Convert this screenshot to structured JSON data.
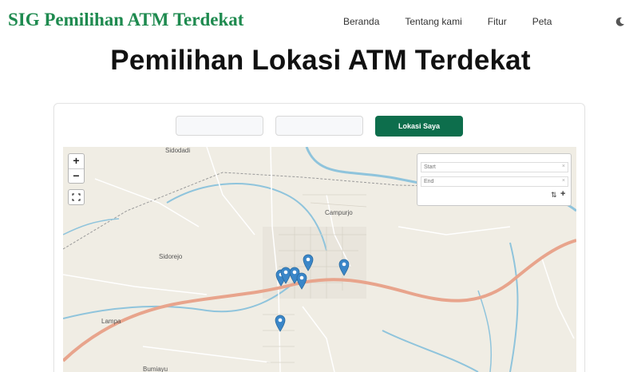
{
  "navbar": {
    "brand": "SIG Pemilihan ATM Terdekat",
    "links": [
      "Beranda",
      "Tentang kami",
      "Fitur",
      "Peta"
    ],
    "theme_icon": "moon-icon"
  },
  "hero": {
    "title": "Pemilihan Lokasi ATM Terdekat"
  },
  "controls": {
    "input_1_value": "",
    "input_2_value": "",
    "locate_button": "Lokasi Saya"
  },
  "map": {
    "zoom_in": "+",
    "zoom_out": "−",
    "places": [
      "Sidodadi",
      "Campurjo",
      "Sidorejo",
      "Lampa",
      "Bumiayu"
    ],
    "routing": {
      "start_placeholder": "Start",
      "end_placeholder": "End",
      "clear_symbol": "×",
      "reverse_symbol": "⇅",
      "add_symbol": "+"
    },
    "marker_color": "#3a86c8",
    "markers": [
      {
        "name": "atm-marker-1"
      },
      {
        "name": "atm-marker-2"
      },
      {
        "name": "atm-marker-3"
      },
      {
        "name": "atm-marker-4"
      },
      {
        "name": "atm-marker-5"
      },
      {
        "name": "atm-marker-6"
      },
      {
        "name": "atm-marker-7"
      }
    ]
  },
  "colors": {
    "brand": "#1e8a4f",
    "button": "#0d6e4c",
    "road": "#e8a48c",
    "river": "#8fc4dc"
  }
}
